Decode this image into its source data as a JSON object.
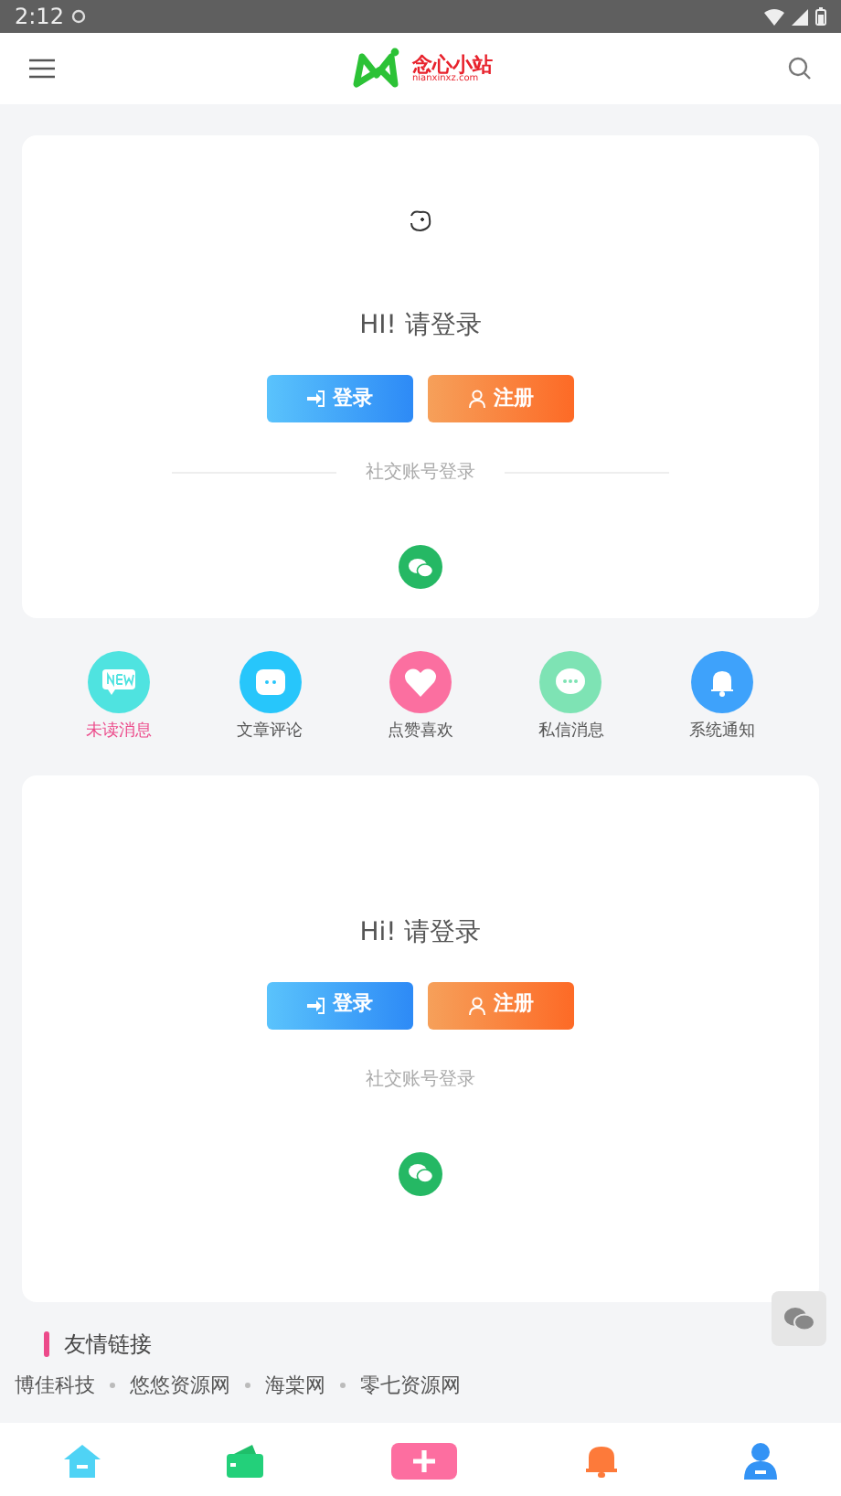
{
  "status_bar": {
    "time": "2:12"
  },
  "header": {
    "logo_text": "念心小站",
    "logo_sub": "nianxinxz.com"
  },
  "login_cards": [
    {
      "show_avatar": true,
      "greeting": "HI!  请登录",
      "buttons": [
        {
          "label": "登录",
          "kind": "login"
        },
        {
          "label": "注册",
          "kind": "register"
        }
      ],
      "social_label": "社交账号登录",
      "divider_lines": true
    },
    {
      "show_avatar": false,
      "greeting": "Hi!  请登录",
      "buttons": [
        {
          "label": "登录",
          "kind": "login"
        },
        {
          "label": "注册",
          "kind": "register"
        }
      ],
      "social_label": "社交账号登录",
      "divider_lines": false
    }
  ],
  "shortcuts": [
    {
      "label": "未读消息",
      "kind": "new",
      "color": "#4fe3e0",
      "selected": true
    },
    {
      "label": "文章评论",
      "kind": "comment",
      "color": "#27c6fb",
      "selected": false
    },
    {
      "label": "点赞喜欢",
      "kind": "heart",
      "color": "#fb6fa0",
      "selected": false
    },
    {
      "label": "私信消息",
      "kind": "chat",
      "color": "#7ee3b4",
      "selected": false
    },
    {
      "label": "系统通知",
      "kind": "bell",
      "color": "#3ea2fb",
      "selected": false
    }
  ],
  "friend_links": {
    "title": "友情链接",
    "links": [
      "博佳科技",
      "悠悠资源网",
      "海棠网",
      "零七资源网"
    ]
  },
  "bottom_nav": [
    {
      "kind": "home"
    },
    {
      "kind": "wallet"
    },
    {
      "kind": "add"
    },
    {
      "kind": "bell"
    },
    {
      "kind": "user"
    }
  ]
}
